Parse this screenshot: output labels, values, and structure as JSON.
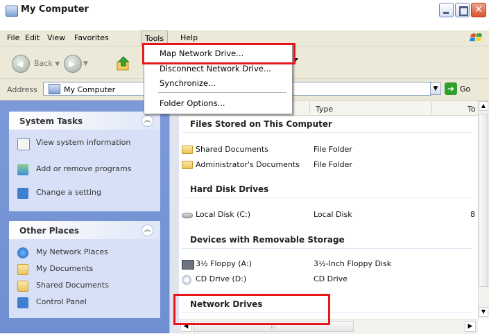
{
  "window": {
    "title": "My Computer"
  },
  "menubar": {
    "file": "File",
    "edit": "Edit",
    "view": "View",
    "favorites": "Favorites",
    "tools": "Tools",
    "help": "Help"
  },
  "toolbar": {
    "back": "Back"
  },
  "address": {
    "label": "Address",
    "value": "My Computer",
    "go": "Go"
  },
  "tools_menu": {
    "items": [
      "Map Network Drive...",
      "Disconnect Network Drive...",
      "Synchronize...",
      "Folder Options..."
    ]
  },
  "system_tasks": {
    "title": "System Tasks",
    "items": [
      "View system information",
      "Add or remove programs",
      "Change a setting"
    ]
  },
  "other_places": {
    "title": "Other Places",
    "items": [
      "My Network Places",
      "My Documents",
      "Shared Documents",
      "Control Panel"
    ]
  },
  "columns": {
    "type": "Type",
    "total": "To"
  },
  "groups": {
    "files": "Files Stored on This Computer",
    "hdd": "Hard Disk Drives",
    "removable": "Devices with Removable Storage",
    "network": "Network Drives"
  },
  "items": {
    "shared_docs": {
      "name": "Shared Documents",
      "type": "File Folder"
    },
    "admin_docs": {
      "name": "Administrator's Documents",
      "type": "File Folder"
    },
    "local_disk": {
      "name": "Local Disk (C:)",
      "type": "Local Disk",
      "size_frag": "8"
    },
    "floppy": {
      "name": "3½ Floppy (A:)",
      "type": "3½-Inch Floppy Disk"
    },
    "cd": {
      "name": "CD Drive (D:)",
      "type": "CD Drive"
    }
  },
  "colors": {
    "highlight": "#e8161b",
    "taskpane": "#7c9ad8"
  }
}
